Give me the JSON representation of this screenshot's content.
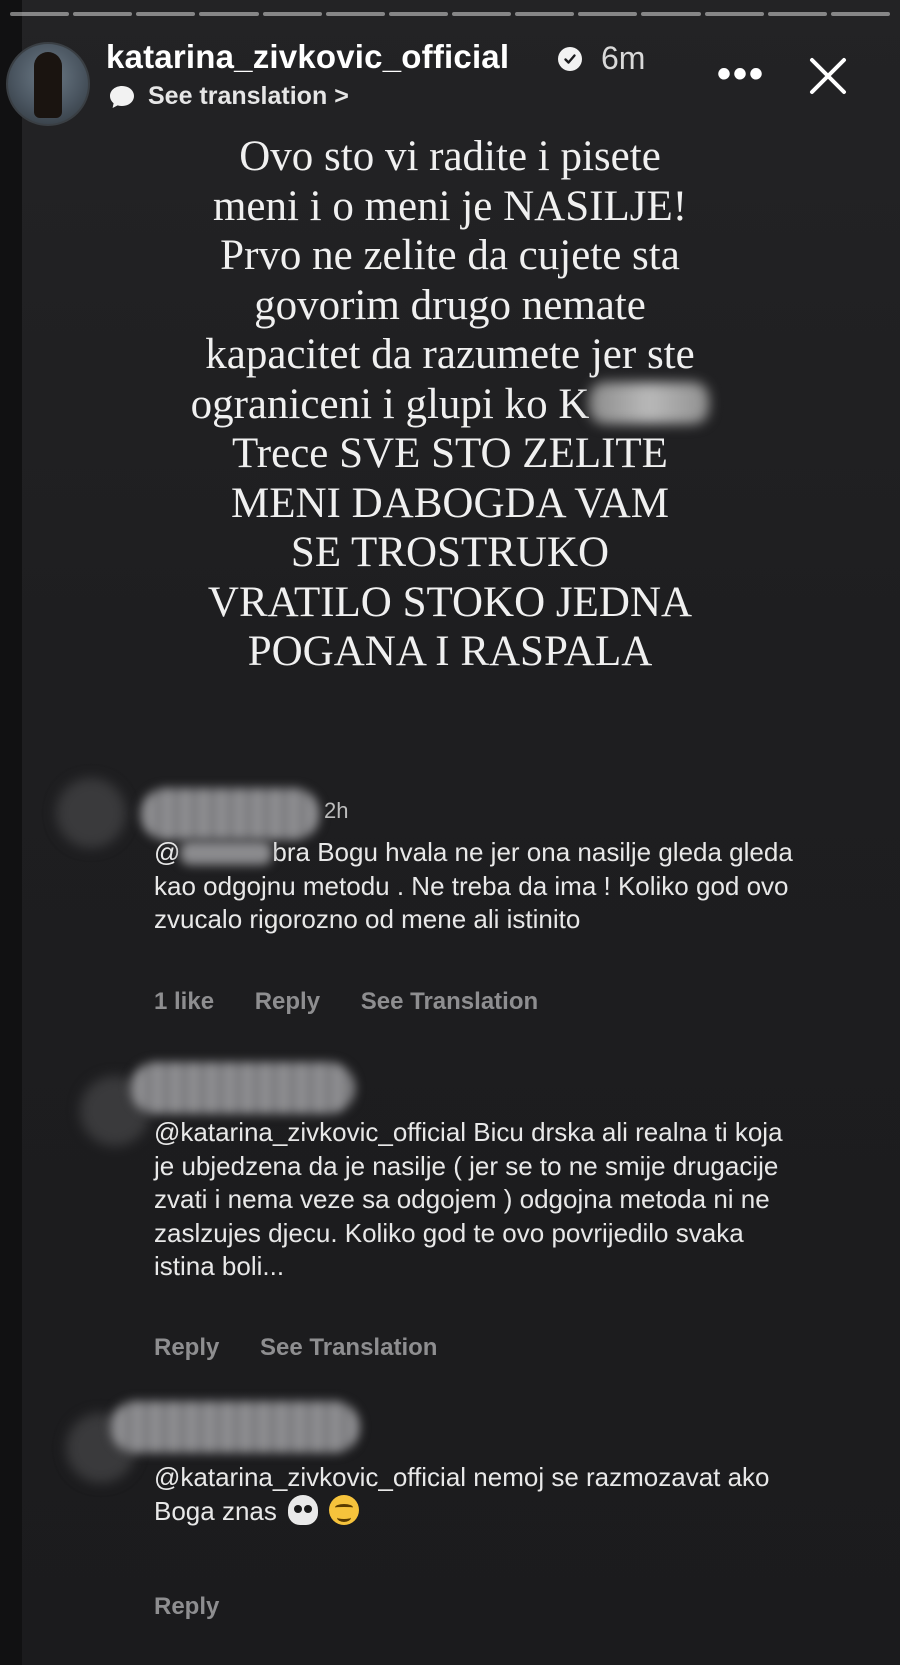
{
  "story": {
    "progress_segments": 14,
    "progress_completed": 0,
    "header": {
      "username": "katarina_zivkovic_official",
      "verified": true,
      "time_ago": "6m",
      "see_translation": "See translation",
      "see_translation_chevron": ">",
      "more_icon": "more-horizontal-icon",
      "close_icon": "close-icon"
    },
    "text_lines": [
      "Ovo sto vi radite i pisete",
      "meni i o meni je NASILJE!",
      "Prvo ne zelite da cujete sta",
      "govorim drugo nemate",
      "kapacitet da razumete jer ste",
      "ograniceni i glupi ko K",
      "Trece SVE STO ZELITE",
      "MENI DABOGDA VAM",
      "SE TROSTRUKO",
      "VRATILO STOKO JEDNA",
      "POGANA I RASPALA"
    ]
  },
  "comments": [
    {
      "time": "2h",
      "text_prefix": "@",
      "text": "bra Bogu hvala ne jer ona nasilje gleda gleda kao odgojnu metodu . Ne treba da ima ! Koliko god ovo zvucalo rigorozno od mene ali istinito",
      "likes": "1 like",
      "reply": "Reply",
      "see_translation": "See Translation"
    },
    {
      "time": "",
      "text": "@katarina_zivkovic_official  Bicu drska ali realna ti koja je ubjedzena da je nasilje ( jer se to ne smije drugacije zvati i nema veze sa odgojem ) odgojna metoda ni ne zaslzujes djecu. Koliko god te ovo povrijedilo svaka istina boli...",
      "reply": "Reply",
      "see_translation": "See Translation"
    },
    {
      "time": "",
      "text": "@katarina_zivkovic_official nemoj se razmozavat ako Boga znas",
      "emojis": [
        "skull-emoji",
        "woozy-face-emoji"
      ],
      "reply": "Reply"
    }
  ],
  "colors": {
    "background": "#1c1c1e",
    "text_primary": "#f0f0f0",
    "text_secondary": "#8e8e90"
  }
}
